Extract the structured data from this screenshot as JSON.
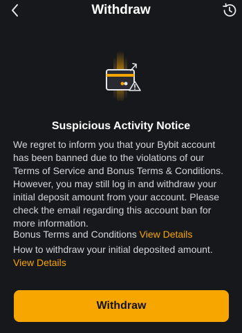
{
  "header": {
    "title": "Withdraw",
    "back_icon": "chevron-left-icon",
    "history_icon": "history-icon"
  },
  "notice": {
    "title": "Suspicious Activity Notice",
    "body": "We regret to inform you that your Bybit account has been banned due to the violations of our Terms of Service and Bonus Terms & Conditions. However, you may still log in and withdraw your initial deposit amount from your account. Please check the email regarding this account ban for more information.",
    "bonus_terms_label": "Bonus Terms and Conditions",
    "bonus_terms_link": "View Details",
    "withdraw_info_label": "How to withdraw your initial deposited amount.",
    "withdraw_info_link": "View Details"
  },
  "action": {
    "withdraw_label": "Withdraw"
  },
  "colors": {
    "background": "#17181c",
    "accent": "#f7a600",
    "text": "#d5d6db"
  }
}
